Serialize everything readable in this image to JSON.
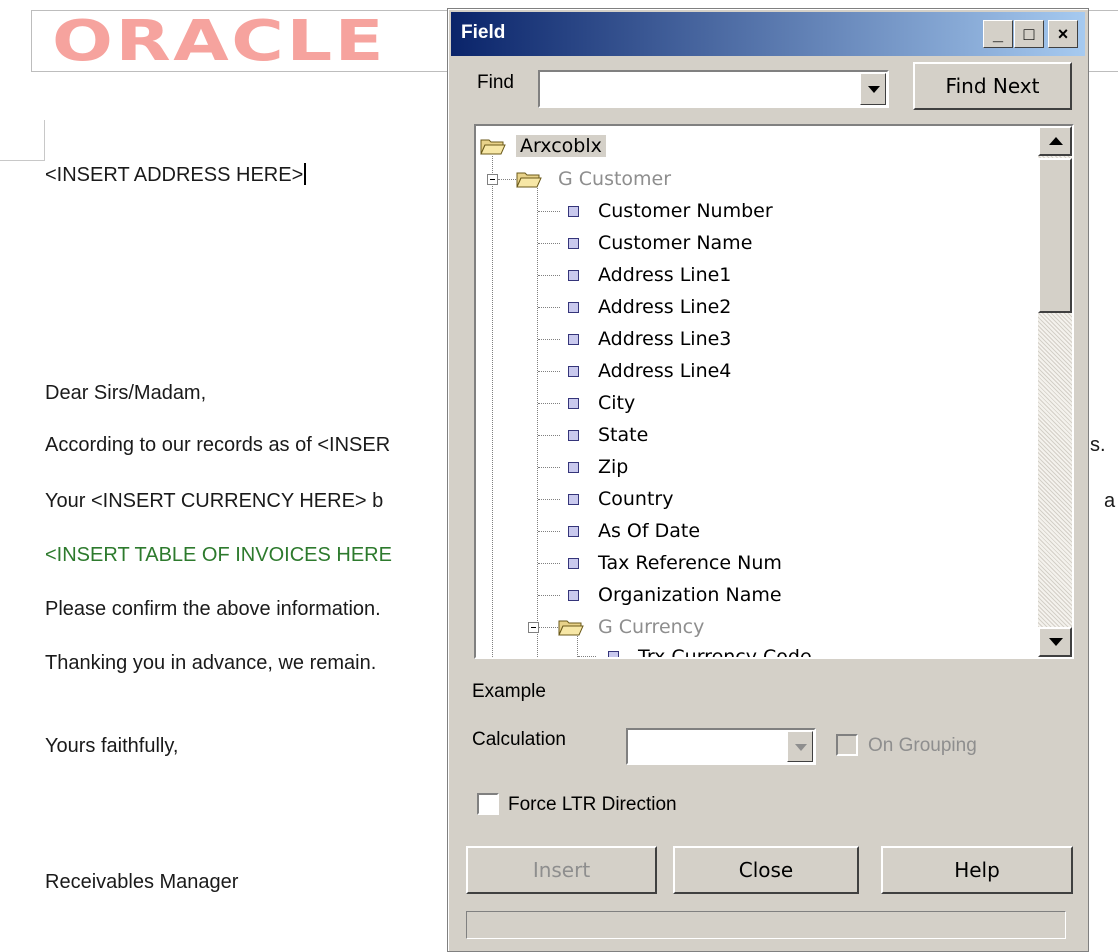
{
  "document": {
    "logo": "ORACLE",
    "address_placeholder": "<INSERT ADDRESS HERE>",
    "greeting": "Dear Sirs/Madam,",
    "line1": "According to our records as of <INSER",
    "line1_tail": "s.",
    "line2": "Your <INSERT CURRENCY HERE> b",
    "line2_tail": "a",
    "line3": "<INSERT TABLE OF INVOICES HERE",
    "line4": "Please confirm the above information.",
    "line5": "Thanking you in advance, we remain.",
    "closing": "Yours faithfully,",
    "signature": "Receivables Manager"
  },
  "dialog": {
    "title": "Field",
    "titlebar_buttons": {
      "minimize": "_",
      "maximize": "□",
      "close": "×"
    },
    "find_label": "Find",
    "find_value": "",
    "find_next_button": "Find Next",
    "tree": {
      "root": "Arxcoblx",
      "group1": "G Customer",
      "fields": [
        "Customer Number",
        "Customer Name",
        "Address Line1",
        "Address Line2",
        "Address Line3",
        "Address Line4",
        "City",
        "State",
        "Zip",
        "Country",
        "As Of Date",
        "Tax Reference Num",
        "Organization Name"
      ],
      "group2": "G Currency",
      "partial_field": "Trx Currency Code"
    },
    "example_label": "Example",
    "calculation_label": "Calculation",
    "calculation_value": "",
    "on_grouping_label": "On Grouping",
    "on_grouping_checked": false,
    "force_ltr_label": "Force LTR Direction",
    "force_ltr_checked": false,
    "insert_button": "Insert",
    "close_button": "Close",
    "help_button": "Help",
    "colors": {
      "titlebar_start": "#0a246a",
      "titlebar_end": "#a6caf0",
      "dialog_face": "#d4d0c8",
      "logo": "#f6a39e",
      "disabled_text": "#8e8e8e"
    }
  }
}
